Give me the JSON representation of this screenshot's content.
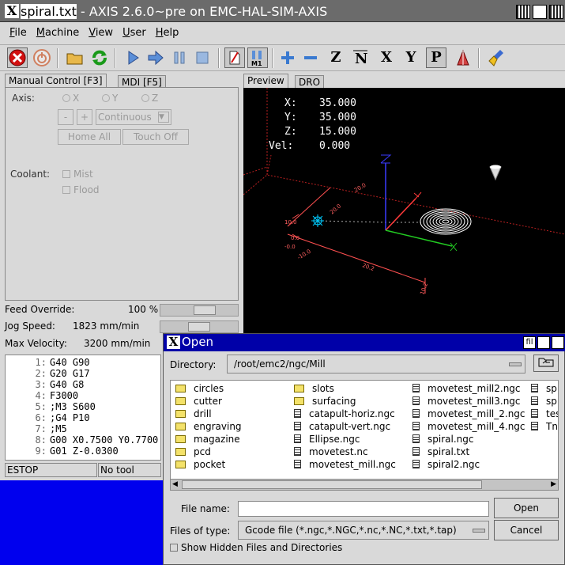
{
  "window": {
    "title_prefix": "spiral.txt",
    "title_suffix": " - AXIS 2.6.0~pre on EMC-HAL-SIM-AXIS"
  },
  "menu": [
    "File",
    "Machine",
    "View",
    "User",
    "Help"
  ],
  "toolbar": {
    "icons": [
      "estop-icon",
      "power-icon",
      "open-file-icon",
      "reload-icon",
      "run-icon",
      "step-icon",
      "pause-icon",
      "stop-icon",
      "block-delete-icon",
      "optional-stop-icon",
      "zoom-in-icon",
      "zoom-out-icon",
      "view-z-icon",
      "view-z2-icon",
      "view-x-icon",
      "view-y-icon",
      "view-p-icon",
      "rotate-icon",
      "clear-plot-icon"
    ],
    "view_z": "Z",
    "view_x": "X",
    "view_y": "Y",
    "view_p": "P"
  },
  "left_tabs": {
    "manual": "Manual Control [F3]",
    "mdi": "MDI [F5]"
  },
  "manual": {
    "axis_label": "Axis:",
    "axes": [
      "X",
      "Y",
      "Z"
    ],
    "minus": "-",
    "plus": "+",
    "jog_mode": "Continuous",
    "home_all": "Home All",
    "touch_off": "Touch Off",
    "coolant_label": "Coolant:",
    "mist": "Mist",
    "flood": "Flood"
  },
  "sliders": {
    "feed_override_label": "Feed Override:",
    "feed_override_value": "100 %",
    "feed_override_fraction": 0.6,
    "jog_speed_label": "Jog Speed:",
    "jog_speed_value": "1823 mm/min",
    "jog_speed_fraction": 0.5,
    "max_velocity_label": "Max Velocity:",
    "max_velocity_value": "3200 mm/min"
  },
  "gcode": [
    {
      "n": "1:",
      "text": "G40 G90"
    },
    {
      "n": "2:",
      "text": "G20 G17"
    },
    {
      "n": "3:",
      "text": "G40 G8"
    },
    {
      "n": "4:",
      "text": "F3000"
    },
    {
      "n": "5:",
      "text": ";M3 S600"
    },
    {
      "n": "6:",
      "text": ";G4 P10"
    },
    {
      "n": "7:",
      "text": ";M5"
    },
    {
      "n": "8:",
      "text": "G00 X0.7500 Y0.7700"
    },
    {
      "n": "9:",
      "text": "G01 Z-0.0300"
    }
  ],
  "status": {
    "estop": "ESTOP",
    "tool": "No tool"
  },
  "preview_tabs": {
    "preview": "Preview",
    "dro": "DRO"
  },
  "dro": {
    "x_label": "X:",
    "x_value": "35.000",
    "y_label": "Y:",
    "y_value": "35.000",
    "z_label": "Z:",
    "z_value": "15.000",
    "vel_label": "Vel:",
    "vel_value": "0.000"
  },
  "preview_dims": {
    "d1": "20.0",
    "d2": "20.0",
    "d3": "10.0",
    "d4": "0.0",
    "d5": "-0.0",
    "d6": "-10.0",
    "d7": "20.2",
    "d8": "10.2"
  },
  "open_dialog": {
    "title": "Open",
    "title_icon_text": "fil",
    "directory_label": "Directory:",
    "directory": "/root/emc2/ngc/Mill",
    "columns": [
      [
        {
          "name": "circles",
          "type": "folder"
        },
        {
          "name": "cutter",
          "type": "folder"
        },
        {
          "name": "drill",
          "type": "folder"
        },
        {
          "name": "engraving",
          "type": "folder"
        },
        {
          "name": "magazine",
          "type": "folder"
        },
        {
          "name": "pcd",
          "type": "folder"
        },
        {
          "name": "pocket",
          "type": "folder"
        }
      ],
      [
        {
          "name": "slots",
          "type": "folder"
        },
        {
          "name": "surfacing",
          "type": "folder"
        },
        {
          "name": "catapult-horiz.ngc",
          "type": "file"
        },
        {
          "name": "catapult-vert.ngc",
          "type": "file"
        },
        {
          "name": "Ellipse.ngc",
          "type": "file"
        },
        {
          "name": "movetest.nc",
          "type": "file"
        },
        {
          "name": "movetest_mill.ngc",
          "type": "file"
        }
      ],
      [
        {
          "name": "movetest_mill2.ngc",
          "type": "file"
        },
        {
          "name": "movetest_mill3.ngc",
          "type": "file"
        },
        {
          "name": "movetest_mill_2.ngc",
          "type": "file"
        },
        {
          "name": "movetest_mill_4.ngc",
          "type": "file"
        },
        {
          "name": "spiral.ngc",
          "type": "file"
        },
        {
          "name": "spiral.txt",
          "type": "file"
        },
        {
          "name": "spiral2.ngc",
          "type": "file"
        }
      ],
      [
        {
          "name": "sp",
          "type": "file"
        },
        {
          "name": "sp",
          "type": "file"
        },
        {
          "name": "tes",
          "type": "file"
        },
        {
          "name": "Tn",
          "type": "file"
        }
      ]
    ],
    "filename_label": "File name:",
    "filename_value": "",
    "open_button": "Open",
    "filetype_label": "Files of type:",
    "filetype": "Gcode file (*.ngc,*.NGC,*.nc,*.NC,*.txt,*.tap)",
    "cancel_button": "Cancel",
    "show_hidden": "Show Hidden Files and Directories"
  },
  "colors": {
    "title_bar": "#6b6b6b",
    "dialog_title": "#0000a8",
    "desktop": "#0000ee",
    "preview_bg": "#000000",
    "limit_lines": "#cc2222",
    "dims": "#ff6060",
    "axis_z": "#3333ff",
    "axis_y": "#ff3333",
    "axis_x": "#22cc22",
    "tool_marker": "#00ccff"
  }
}
